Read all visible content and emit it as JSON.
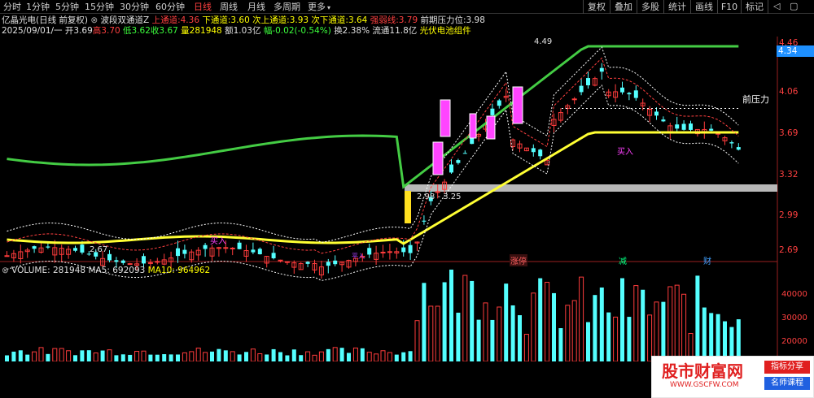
{
  "toolbar": {
    "tabs": [
      {
        "label": "分时",
        "active": false
      },
      {
        "label": "1分钟",
        "active": false
      },
      {
        "label": "5分钟",
        "active": false
      },
      {
        "label": "15分钟",
        "active": false
      },
      {
        "label": "30分钟",
        "active": false
      },
      {
        "label": "60分钟",
        "active": false
      },
      {
        "label": "日线",
        "active": true
      },
      {
        "label": "周线",
        "active": false
      },
      {
        "label": "月线",
        "active": false
      },
      {
        "label": "多周期",
        "active": false
      },
      {
        "label": "更多",
        "active": false
      }
    ],
    "right_buttons": [
      "复权",
      "叠加",
      "多股",
      "统计",
      "画线",
      "F10",
      "标记"
    ]
  },
  "info_line1": {
    "stock": "亿晶光电(日线 前复权)",
    "indicator": "波段双通道Z",
    "items": [
      {
        "label": "上通道:",
        "value": "4.36",
        "color": "#ff4040"
      },
      {
        "label": "下通道:",
        "value": "3.60",
        "color": "#ffff00"
      },
      {
        "label": "次上通道:",
        "value": "3.93",
        "color": "#ffff00"
      },
      {
        "label": "次下通道:",
        "value": "3.64",
        "color": "#ffff00"
      },
      {
        "label": "强弱线:",
        "value": "3.79",
        "color": "#ff4040"
      },
      {
        "label": "前期压力位:",
        "value": "3.98",
        "color": "#e0e0e0"
      }
    ]
  },
  "info_line2": {
    "date": "2025/09/01/一",
    "open": "开3.69",
    "high": "高3.70",
    "low": "低3.62",
    "close": "收3.67",
    "volume": "量281948",
    "amount": "额1.03亿",
    "change": "幅-0.02(-0.54%)",
    "turnover": "换2.38%",
    "float_cap": "流通11.8亿",
    "sector": "光伏电池组件"
  },
  "price_axis": {
    "ticks": [
      "4.46",
      "4.06",
      "3.69",
      "3.32",
      "2.99",
      "2.69"
    ],
    "current_price_tag": "4.34"
  },
  "annotations": {
    "high_label": "4.49",
    "low_label": "2.67",
    "range_label": "2.98 - 3.25",
    "pressure_label": "前压力",
    "buy_label": "买入",
    "buy_label2": "买入",
    "event_zhangting": "涨停",
    "event_jian": "减",
    "event_cai": "财",
    "event_zhi": "平入"
  },
  "volume_panel": {
    "title": "VOLUME: 281948",
    "ma5": "MA5: 692093",
    "ma10": "MA10: 964962",
    "ticks": [
      "40000",
      "30000",
      "20000",
      "10000"
    ]
  },
  "ad": {
    "brand": "股市财富网",
    "url": "WWW.GSCFW.COM",
    "btn1": "指标分享",
    "btn2": "名师课程"
  },
  "colors": {
    "up": "#ff3c3c",
    "down": "#54ffff",
    "upper_channel": "#44cc44",
    "lower_channel": "#ffff33",
    "ma5": "#ffffff",
    "ma10": "#ffff00"
  }
}
